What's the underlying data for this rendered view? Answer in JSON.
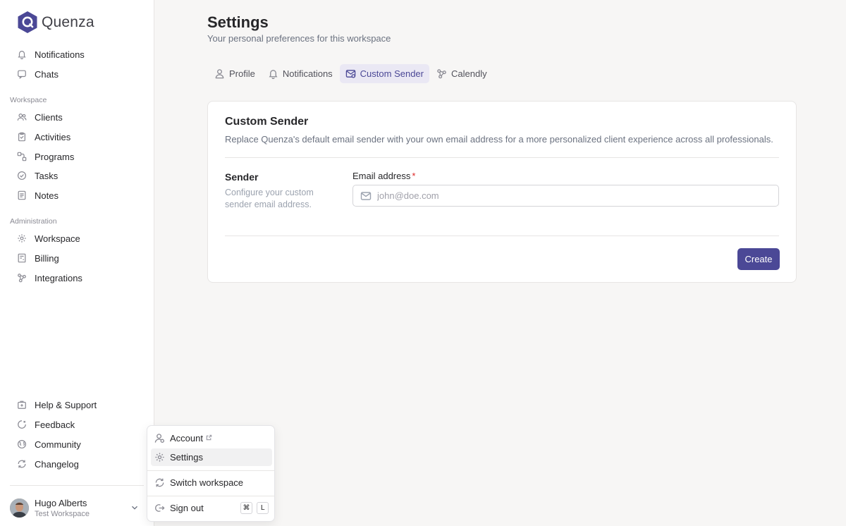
{
  "brand": {
    "name": "Quenza",
    "color": "#4b4896"
  },
  "sidebar": {
    "top_items": [
      {
        "label": "Notifications",
        "icon": "bell-icon"
      },
      {
        "label": "Chats",
        "icon": "chat-icon"
      }
    ],
    "workspace_label": "Workspace",
    "workspace_items": [
      {
        "label": "Clients",
        "icon": "users-icon"
      },
      {
        "label": "Activities",
        "icon": "clipboard-icon"
      },
      {
        "label": "Programs",
        "icon": "programs-icon"
      },
      {
        "label": "Tasks",
        "icon": "check-circle-icon"
      },
      {
        "label": "Notes",
        "icon": "note-icon"
      }
    ],
    "admin_label": "Administration",
    "admin_items": [
      {
        "label": "Workspace",
        "icon": "gear-icon"
      },
      {
        "label": "Billing",
        "icon": "billing-icon"
      },
      {
        "label": "Integrations",
        "icon": "integrations-icon"
      }
    ],
    "bottom_items": [
      {
        "label": "Help & Support",
        "icon": "help-icon"
      },
      {
        "label": "Feedback",
        "icon": "feedback-icon"
      },
      {
        "label": "Community",
        "icon": "globe-icon"
      },
      {
        "label": "Changelog",
        "icon": "refresh-icon"
      }
    ],
    "user": {
      "name": "Hugo Alberts",
      "workspace": "Test Workspace"
    }
  },
  "header": {
    "title": "Settings",
    "subtitle": "Your personal preferences for this workspace"
  },
  "tabs": [
    {
      "label": "Profile",
      "icon": "user-icon",
      "active": false
    },
    {
      "label": "Notifications",
      "icon": "bell-icon",
      "active": false
    },
    {
      "label": "Custom Sender",
      "icon": "mail-icon",
      "active": true
    },
    {
      "label": "Calendly",
      "icon": "calendly-icon",
      "active": false
    }
  ],
  "card": {
    "title": "Custom Sender",
    "description": "Replace Quenza's default email sender with your own email address for a more personalized client experience across all professionals.",
    "section_title": "Sender",
    "section_description": "Configure your custom sender email address.",
    "field_label": "Email address",
    "required_mark": "*",
    "field_placeholder": "john@doe.com",
    "field_value": "",
    "submit_label": "Create"
  },
  "user_menu": {
    "items": [
      {
        "label": "Account",
        "icon": "account-icon"
      },
      {
        "label": "Settings",
        "icon": "gear-icon"
      },
      {
        "label": "Switch workspace",
        "icon": "refresh-icon"
      },
      {
        "label": "Sign out",
        "icon": "sign-out-icon"
      }
    ],
    "shortcut": [
      "⌘",
      "L"
    ]
  }
}
